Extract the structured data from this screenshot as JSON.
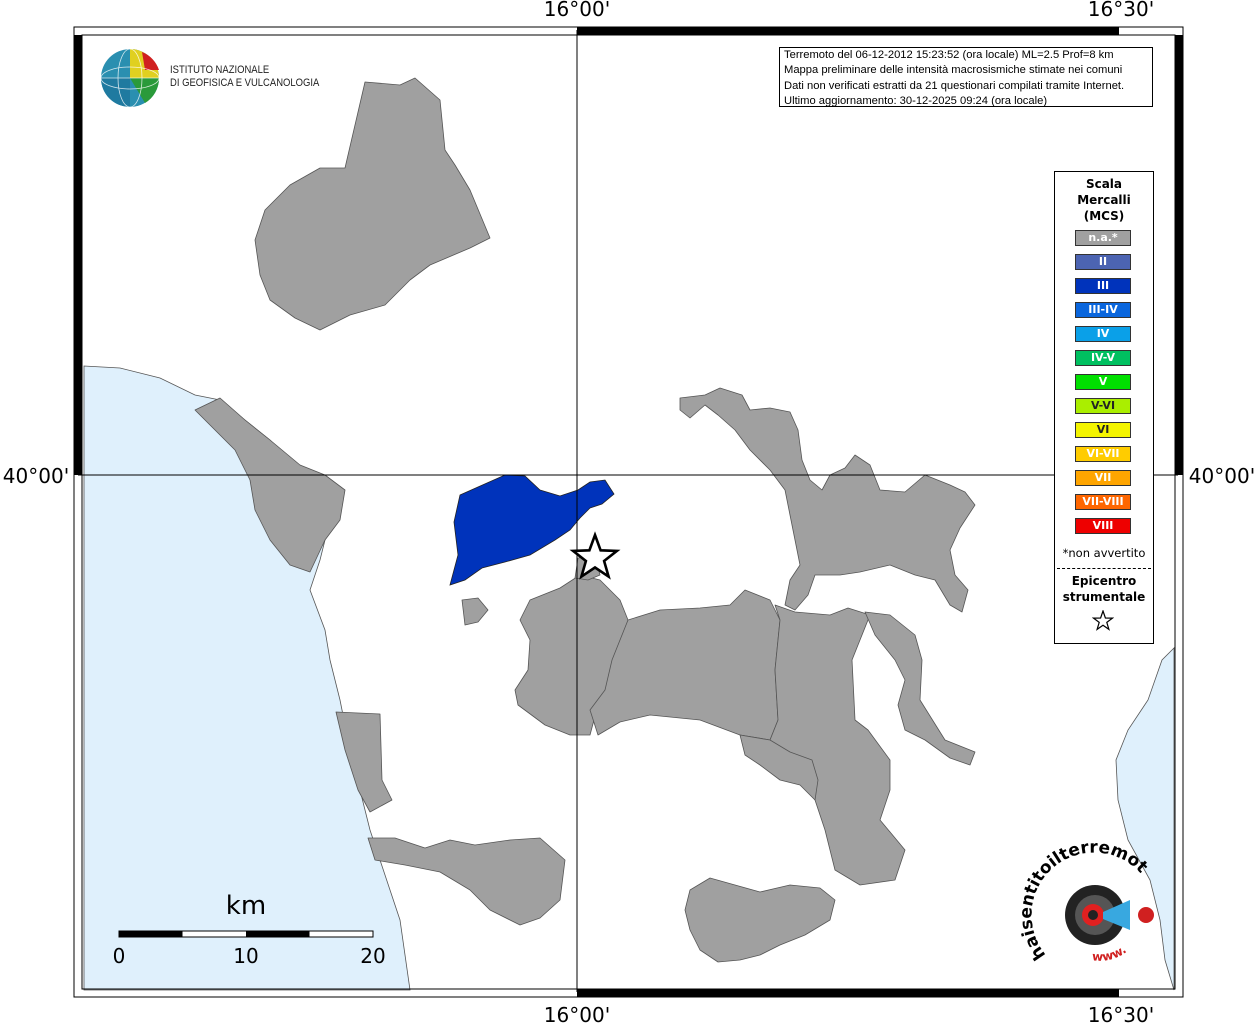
{
  "map": {
    "lon_ticks": [
      "16°00'",
      "16°30'"
    ],
    "lat_ticks": [
      "40°00'"
    ],
    "scale_bar": {
      "unit": "km",
      "labels": [
        "0",
        "10",
        "20"
      ]
    }
  },
  "logo_ingv": {
    "line1": "ISTITUTO NAZIONALE",
    "line2": "DI GEOFISICA E VULCANOLOGIA"
  },
  "info_box": {
    "lines": [
      "Terremoto del 06-12-2012 15:23:52 (ora locale) ML=2.5 Prof=8 km",
      "Mappa preliminare delle intensità macrosismiche stimate nei comuni",
      "Dati non verificati estratti da 21 questionari compilati tramite Internet.",
      "Ultimo aggiornamento: 30-12-2025 09:24 (ora locale)"
    ]
  },
  "legend": {
    "title": [
      "Scala",
      "Mercalli",
      "(MCS)"
    ],
    "items": [
      {
        "label": "n.a.*",
        "color": "#a0a0a0"
      },
      {
        "label": "II",
        "color": "#4c64b2"
      },
      {
        "label": "III",
        "color": "#0033bb"
      },
      {
        "label": "III-IV",
        "color": "#0a66dd"
      },
      {
        "label": "IV",
        "color": "#0aa0e8"
      },
      {
        "label": "IV-V",
        "color": "#00c060"
      },
      {
        "label": "V",
        "color": "#00e000"
      },
      {
        "label": "V-VI",
        "color": "#aaee00"
      },
      {
        "label": "VI",
        "color": "#f4f400"
      },
      {
        "label": "VI-VII",
        "color": "#ffcc00"
      },
      {
        "label": "VII",
        "color": "#ffa500"
      },
      {
        "label": "VII-VIII",
        "color": "#ff6600"
      },
      {
        "label": "VIII",
        "color": "#ee0000"
      }
    ],
    "note": "*non avvertito",
    "epicenter_label": [
      "Epicentro",
      "strumentale"
    ]
  },
  "logo_hst": {
    "text": "haisentitoilterremoto.it",
    "www": "www."
  },
  "colors": {
    "sea": "#dff0fc",
    "municipality_na": "#a0a0a0",
    "intensity_iii": "#0033bb"
  }
}
